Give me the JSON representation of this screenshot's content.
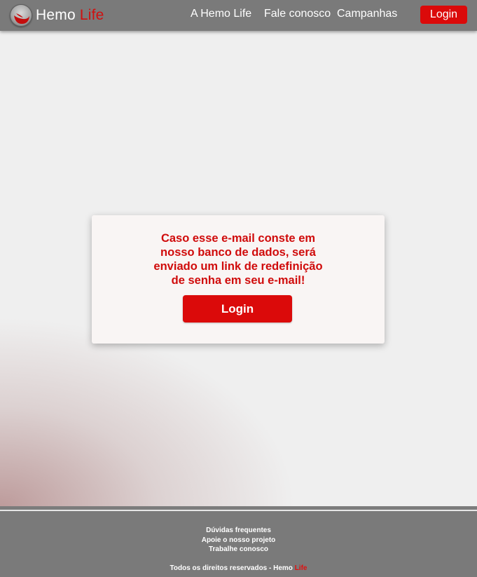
{
  "header": {
    "logo_text": "Hemo",
    "logo_accent": "Life",
    "nav": [
      {
        "label": "A Hemo Life"
      },
      {
        "label": "Fale conosco"
      },
      {
        "label": "Campanhas"
      }
    ],
    "login_label": "Login"
  },
  "card": {
    "message": "Caso esse e-mail conste em nosso banco de dados, será enviado um link de redefinição de senha em seu e-mail!",
    "button_label": "Login"
  },
  "footer": {
    "links": [
      {
        "label": "Dúvidas frequentes"
      },
      {
        "label": "Apoie o nosso projeto"
      },
      {
        "label": "Trabalhe conosco"
      }
    ],
    "copyright_prefix": "Todos os direitos reservados - Hemo",
    "copyright_accent": "Life"
  },
  "colors": {
    "brand_red": "#db0a0a",
    "nav_gray": "#7a7a7a",
    "page_background": "#efefef",
    "card_background": "#f9f5f4"
  },
  "icons": {
    "logo": "blood-drop-logo-icon"
  }
}
